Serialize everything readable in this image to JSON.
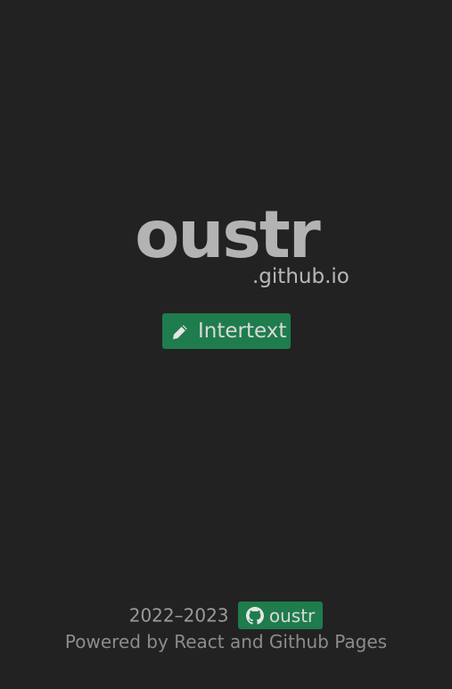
{
  "header": {
    "title": "oustr",
    "subtitle": ".github.io"
  },
  "main": {
    "intertext_button": {
      "label": "Intertext",
      "icon": "pencil-icon"
    }
  },
  "footer": {
    "years": "2022–2023",
    "github_badge": {
      "label": "oustr",
      "icon": "github-icon"
    },
    "powered_by": "Powered by React and Github Pages"
  },
  "colors": {
    "background": "#222222",
    "accent": "#1f7c4c",
    "title": "#b3b3b3",
    "text_muted": "#9a9a9a"
  }
}
